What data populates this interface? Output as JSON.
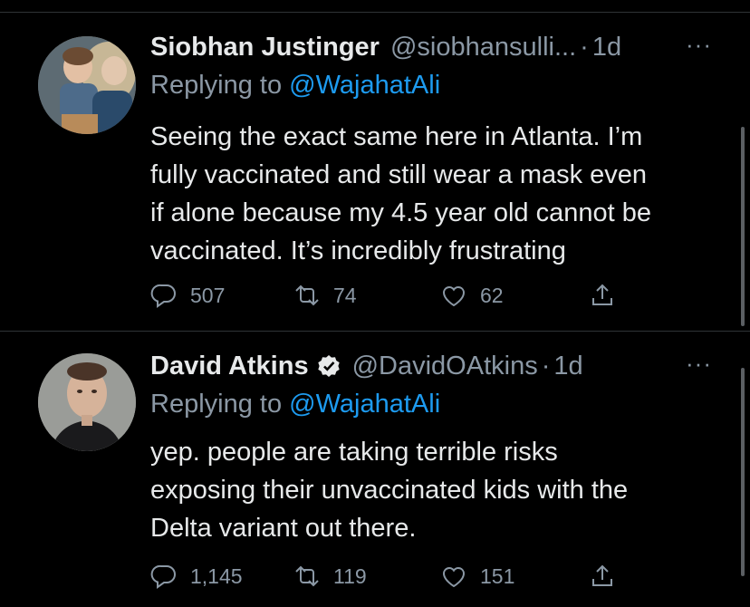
{
  "tweets": [
    {
      "author_name": "Siobhan Justinger",
      "handle": "@siobhansulli...",
      "separator": "·",
      "time": "1d",
      "more": "···",
      "replying_prefix": "Replying to",
      "replying_to": "@WajahatAli",
      "text_lines": [
        "Seeing the exact same here in Atlanta. I’m",
        "fully vaccinated and still wear a mask even",
        "if alone because my 4.5 year old cannot be",
        "vaccinated. It’s incredibly frustrating"
      ],
      "replies": "507",
      "retweets": "74",
      "likes": "62",
      "verified": false
    },
    {
      "author_name": "David Atkins",
      "handle": "@DavidOAtkins",
      "separator": "·",
      "time": "1d",
      "more": "···",
      "replying_prefix": "Replying to",
      "replying_to": "@WajahatAli",
      "text_lines": [
        "yep. people are taking terrible risks",
        "exposing their unvaccinated kids with the",
        "Delta variant out there."
      ],
      "replies": "1,145",
      "retweets": "119",
      "likes": "151",
      "verified": true
    }
  ],
  "colors": {
    "background": "#000000",
    "text": "#e7e9ea",
    "muted": "#8b98a5",
    "link": "#1d9bf0",
    "divider": "#2f3336"
  },
  "icons": [
    "reply-icon",
    "retweet-icon",
    "like-icon",
    "share-icon",
    "verified-badge-icon",
    "more-icon"
  ]
}
